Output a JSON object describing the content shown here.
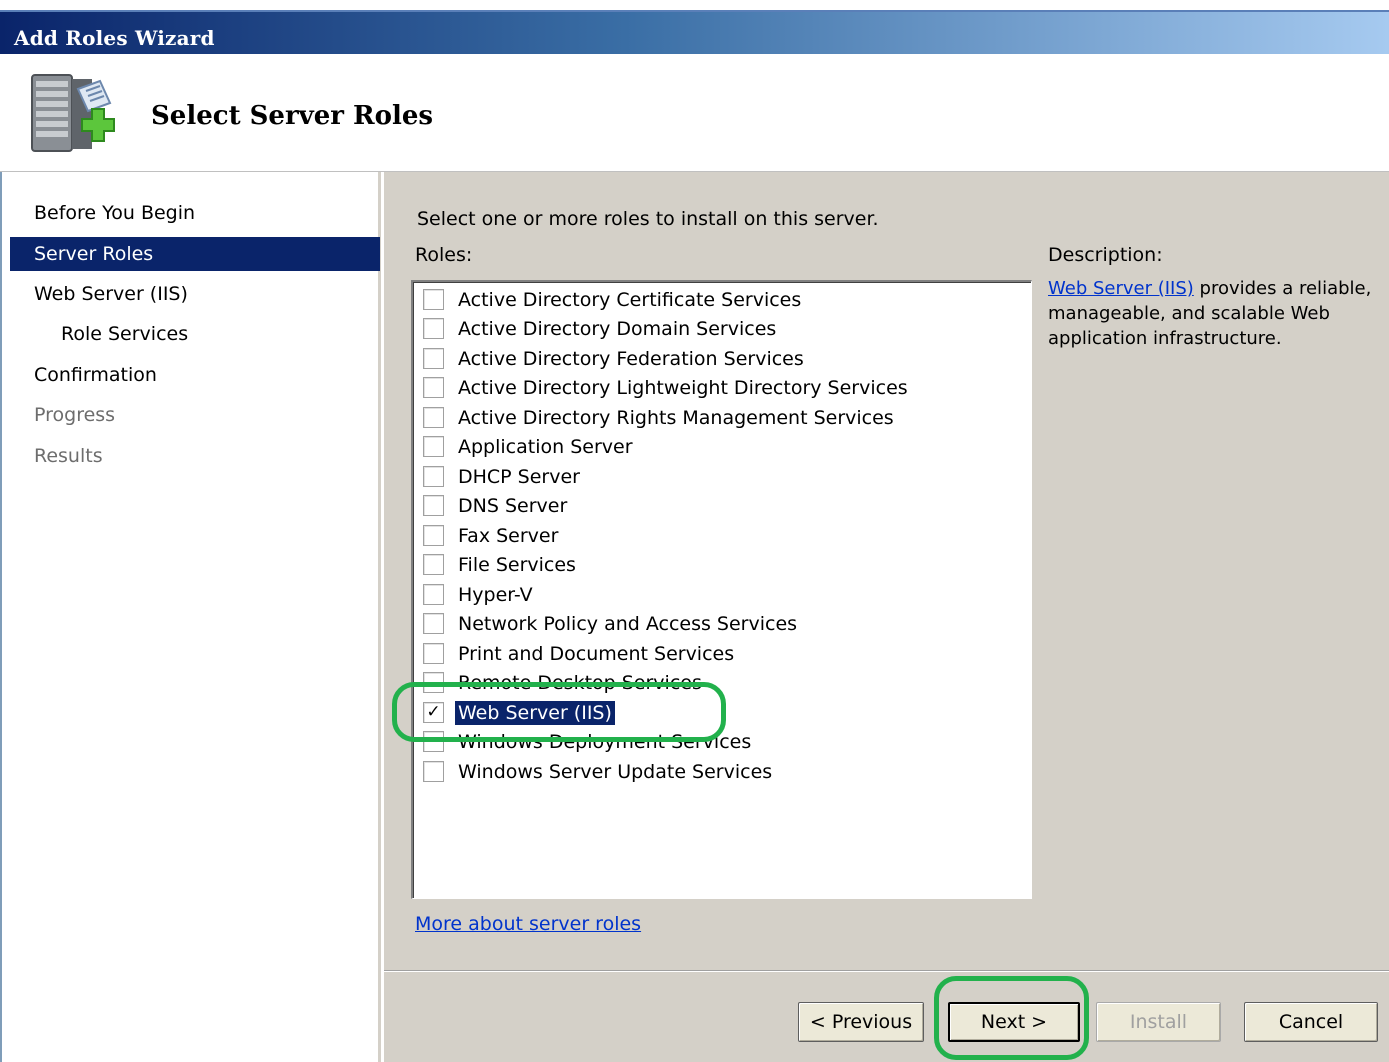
{
  "window": {
    "title": "Add Roles Wizard"
  },
  "header": {
    "page_title": "Select Server Roles",
    "icon": "server-add-icon"
  },
  "nav": {
    "items": [
      {
        "label": "Before You Begin",
        "state": "normal"
      },
      {
        "label": "Server Roles",
        "state": "active"
      },
      {
        "label": "Web Server (IIS)",
        "state": "normal"
      },
      {
        "label": "Role Services",
        "state": "normal"
      },
      {
        "label": "Confirmation",
        "state": "normal"
      },
      {
        "label": "Progress",
        "state": "disabled"
      },
      {
        "label": "Results",
        "state": "disabled"
      }
    ]
  },
  "main": {
    "instruction": "Select one or more roles to install on this server.",
    "roles_label": "Roles:",
    "description_label": "Description:",
    "description": {
      "link_text": "Web Server (IIS)",
      "text": " provides a reliable, manageable, and scalable Web application infrastructure."
    },
    "roles": [
      {
        "label": "Active Directory Certificate Services",
        "checked": false
      },
      {
        "label": "Active Directory Domain Services",
        "checked": false
      },
      {
        "label": "Active Directory Federation Services",
        "checked": false
      },
      {
        "label": "Active Directory Lightweight Directory Services",
        "checked": false
      },
      {
        "label": "Active Directory Rights Management Services",
        "checked": false
      },
      {
        "label": "Application Server",
        "checked": false
      },
      {
        "label": "DHCP Server",
        "checked": false
      },
      {
        "label": "DNS Server",
        "checked": false
      },
      {
        "label": "Fax Server",
        "checked": false
      },
      {
        "label": "File Services",
        "checked": false
      },
      {
        "label": "Hyper-V",
        "checked": false
      },
      {
        "label": "Network Policy and Access Services",
        "checked": false
      },
      {
        "label": "Print and Document Services",
        "checked": false
      },
      {
        "label": "Remote Desktop Services",
        "checked": false
      },
      {
        "label": "Web Server (IIS)",
        "checked": true
      },
      {
        "label": "Windows Deployment Services",
        "checked": false
      },
      {
        "label": "Windows Server Update Services",
        "checked": false
      }
    ],
    "more_link": "More about server roles"
  },
  "buttons": {
    "previous": "< Previous",
    "next": "Next >",
    "install": "Install",
    "cancel": "Cancel"
  },
  "colors": {
    "selection": "#0a246a",
    "annotation": "#22b14c",
    "link": "#0033cc"
  }
}
